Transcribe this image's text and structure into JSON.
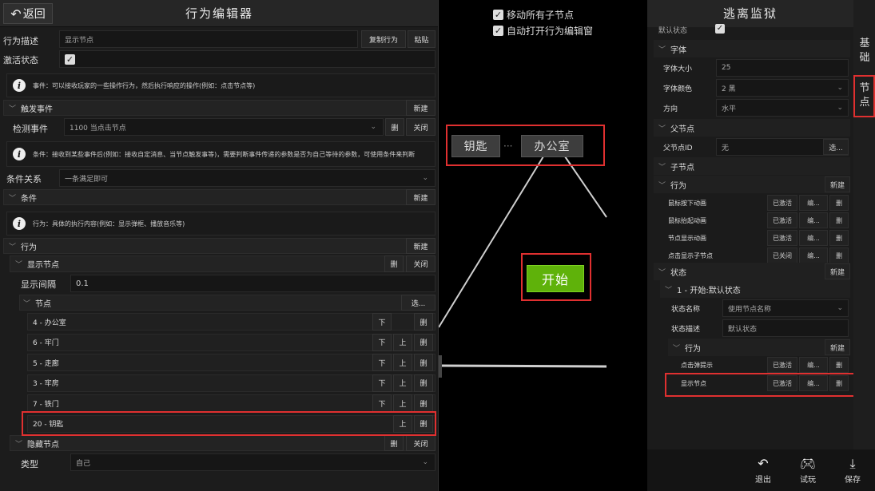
{
  "left": {
    "back_label": "返回",
    "title": "行为编辑器",
    "desc_label": "行为描述",
    "desc_value": "显示节点",
    "copy_btn": "复制行为",
    "paste_btn": "粘贴",
    "active_label": "激活状态",
    "info_event": "事件：可以接收玩家的一些操作行为，然后执行响应的操作(例如：点击节点等)",
    "trigger_section": "触发事件",
    "new1": "新建",
    "detect_label": "检测事件",
    "detect_value": "1100 当点击节点",
    "del1": "删",
    "close1": "关闭",
    "info_cond": "条件：接收到某些事件后(例如：接收自定消息、当节点触发事等)，需要判断事件传递的参数是否为自己等待的参数，可使用条件来判断",
    "cond_rel_label": "条件关系",
    "cond_rel_value": "一条满足即可",
    "cond_section": "条件",
    "new2": "新建",
    "info_action": "行为：具体的执行内容(例如：显示弹框、播放音乐等)",
    "action_section": "行为",
    "new3": "新建",
    "show_section": "显示节点",
    "del2": "删",
    "close2": "关闭",
    "interval_label": "显示间隔",
    "interval_value": "0.1",
    "nodes_section": "节点",
    "select_btn": "选...",
    "nodes": [
      {
        "label": "4 - 办公室",
        "down": "下",
        "up": "",
        "del": "删"
      },
      {
        "label": "6 - 牢门",
        "down": "下",
        "up": "上",
        "del": "删"
      },
      {
        "label": "5 - 走廊",
        "down": "下",
        "up": "上",
        "del": "删"
      },
      {
        "label": "3 - 牢房",
        "down": "下",
        "up": "上",
        "del": "删"
      },
      {
        "label": "7 - 铁门",
        "down": "下",
        "up": "上",
        "del": "删"
      },
      {
        "label": "20 - 钥匙",
        "down": "",
        "up": "上",
        "del": "删"
      }
    ],
    "hide_section": "隐藏节点",
    "del3": "删",
    "close3": "关闭",
    "type_label": "类型",
    "type_value": "自己"
  },
  "center": {
    "opt1": "移动所有子节点",
    "opt2": "自动打开行为编辑窗",
    "node_key": "钥匙",
    "node_office": "办公室",
    "node_start": "开始",
    "dots": "···"
  },
  "right": {
    "title": "逃离监狱",
    "default_state": "默认状态",
    "font_section": "字体",
    "font_size_label": "字体大小",
    "font_size_value": "25",
    "font_color_label": "字体颜色",
    "font_color_value": "2 黑",
    "dir_label": "方向",
    "dir_value": "水平",
    "parent_section": "父节点",
    "parent_id_label": "父节点ID",
    "parent_id_value": "无",
    "parent_select": "选...",
    "child_section": "子节点",
    "behavior_section": "行为",
    "new_b": "新建",
    "behaviors": [
      {
        "label": "鼠标按下动画",
        "state": "已激活",
        "edit": "编...",
        "del": "删"
      },
      {
        "label": "鼠标抬起动画",
        "state": "已激活",
        "edit": "编...",
        "del": "删"
      },
      {
        "label": "节点显示动画",
        "state": "已激活",
        "edit": "编...",
        "del": "删"
      },
      {
        "label": "点击显示子节点",
        "state": "已关闭",
        "edit": "编...",
        "del": "删"
      }
    ],
    "state_section": "状态",
    "new_s": "新建",
    "state_item": "1 - 开始:默认状态",
    "state_name_label": "状态名称",
    "state_name_value": "使用节点名称",
    "state_desc_label": "状态描述",
    "state_desc_value": "默认状态",
    "sb_section": "行为",
    "new_sb": "新建",
    "sb_items": [
      {
        "label": "点击弹提示",
        "state": "已激活",
        "edit": "编...",
        "del": "删"
      },
      {
        "label": "显示节点",
        "state": "已激活",
        "edit": "编...",
        "del": "删"
      }
    ],
    "tab_basic": "基础",
    "tab_node": "节点",
    "exit": "退出",
    "play": "试玩",
    "save": "保存"
  }
}
